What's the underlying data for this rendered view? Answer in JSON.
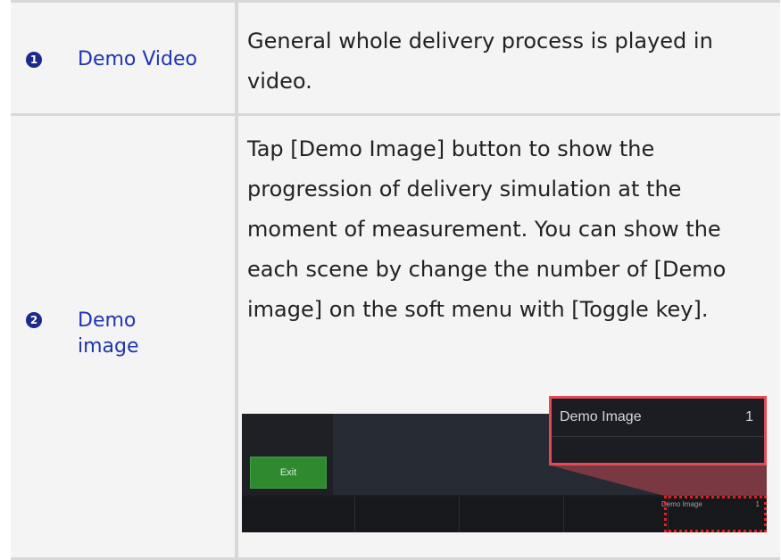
{
  "rows": [
    {
      "number": "1",
      "label": "Demo Video",
      "description": "General whole delivery process is played in video."
    },
    {
      "number": "2",
      "label": "Demo image",
      "description": "Tap [Demo Image] button to show the progression of delivery simulation at the moment of measurement. You can show the each scene by change the number of [Demo image] on the soft menu with [Toggle key]."
    }
  ],
  "screenshot": {
    "exit_label": "Exit",
    "soft_menu_item": {
      "label": "Demo Image",
      "value": "1"
    },
    "callout": {
      "label": "Demo Image",
      "value": "1"
    }
  },
  "colors": {
    "label_blue": "#1f35b0",
    "badge_navy": "#1b2a8c",
    "highlight_red": "#e02020",
    "exit_green": "#2f8a2f"
  }
}
